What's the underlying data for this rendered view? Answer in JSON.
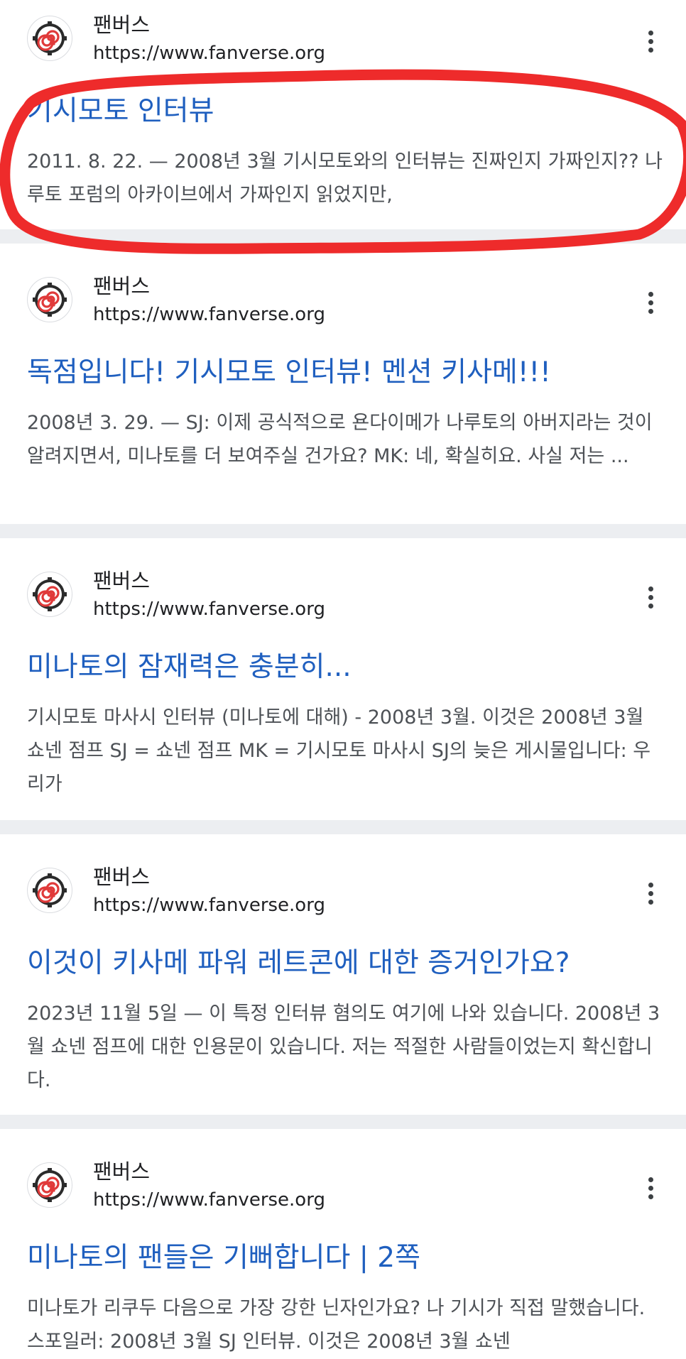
{
  "results": [
    {
      "site_name": "팬버스",
      "url": "https://www.fanverse.org",
      "title": "기시모토 인터뷰",
      "snippet": "2011. 8. 22. — 2008년 3월 기시모토와의 인터뷰는 진짜인지 가짜인지?? 나루토 포럼의 아카이브에서 가짜인지 읽었지만,"
    },
    {
      "site_name": "팬버스",
      "url": "https://www.fanverse.org",
      "title": "독점입니다! 기시모토 인터뷰! 멘션 키사메!!!",
      "snippet": "2008년 3. 29. — SJ: 이제 공식적으로 욘다이메가 나루토의 아버지라는 것이 알려지면서, 미나토를 더 보여주실 건가요? MK: 네, 확실히요. 사실 저는 ..."
    },
    {
      "site_name": "팬버스",
      "url": "https://www.fanverse.org",
      "title": "미나토의 잠재력은 충분히...",
      "snippet": "기시모토 마사시 인터뷰 (미나토에 대해) - 2008년 3월. 이것은 2008년 3월 쇼넨 점프 SJ = 쇼넨 점프 MK = 기시모토 마사시 SJ의 늦은 게시물입니다: 우리가"
    },
    {
      "site_name": "팬버스",
      "url": "https://www.fanverse.org",
      "title": "이것이 키사메 파워 레트콘에 대한 증거인가요?",
      "snippet": "2023년 11월 5일 — 이 특정 인터뷰 혐의도 여기에 나와 있습니다. 2008년 3월 쇼넨 점프에 대한 인용문이 있습니다. 저는 적절한 사람들이었는지 확신합니다."
    },
    {
      "site_name": "팬버스",
      "url": "https://www.fanverse.org",
      "title": "미나토의 팬들은 기뻐합니다 | 2쪽",
      "snippet": "미나토가 리쿠두 다음으로 가장 강한 닌자인가요? 나 기시가 직접 말했습니다. 스포일러: 2008년 3월 SJ 인터뷰. 이것은 2008년 3월 쇼넨"
    }
  ],
  "icons": {
    "favicon": "red-spiral-gear-icon",
    "menu": "more-vert-icon"
  },
  "colors": {
    "title_link": "#1f5fbf",
    "snippet_text": "#4d5156",
    "divider": "#eceef1",
    "annotation": "#ee2b2b"
  }
}
